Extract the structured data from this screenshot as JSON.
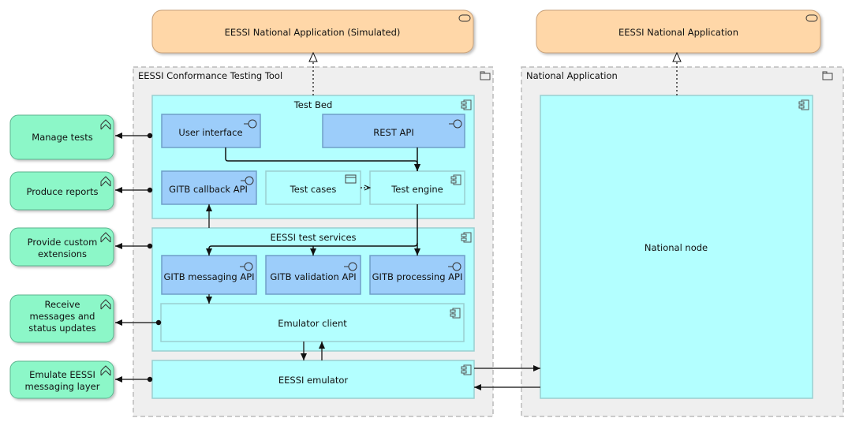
{
  "colors": {
    "app_interface": "#9ccdfa",
    "app_component": "#b3ffff",
    "business_service": "#8cf7c8",
    "external_app": "#ffd7a8",
    "group": "#efefef"
  },
  "external": {
    "simulated": "EESSI National Application (Simulated)",
    "real": "EESSI National Application"
  },
  "groups": {
    "ctt": "EESSI Conformance Testing Tool",
    "national": "National Application"
  },
  "test_bed": {
    "title": "Test Bed",
    "user_interface": "User interface",
    "rest_api": "REST API",
    "callback_api": "GITB callback API",
    "test_cases": "Test cases",
    "test_engine": "Test engine"
  },
  "test_services": {
    "title": "EESSI test services",
    "messaging_api": "GITB messaging API",
    "validation_api": "GITB validation API",
    "processing_api": "GITB processing API",
    "emulator_client": "Emulator client"
  },
  "emulator": "EESSI emulator",
  "national_node": "National node",
  "services": [
    [
      "Manage tests"
    ],
    [
      "Produce reports"
    ],
    [
      "Provide custom",
      "extensions"
    ],
    [
      "Receive",
      "messages and",
      "status updates"
    ],
    [
      "Emulate EESSI",
      "messaging layer"
    ]
  ]
}
